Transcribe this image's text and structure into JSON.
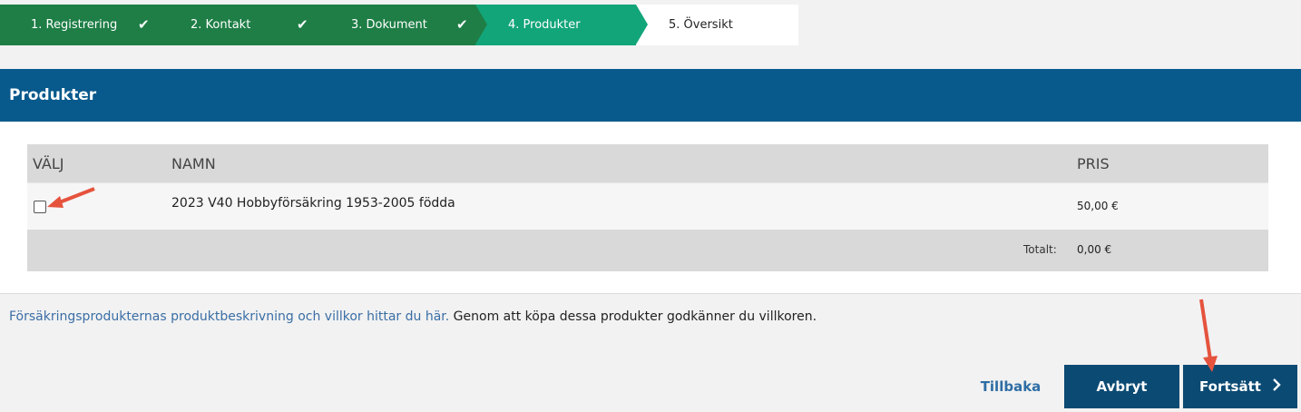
{
  "stepper": {
    "steps": [
      {
        "label": "1. Registrering",
        "check": "✔"
      },
      {
        "label": "2. Kontakt",
        "check": "✔"
      },
      {
        "label": "3. Dokument",
        "check": "✔"
      },
      {
        "label": "4. Produkter"
      },
      {
        "label": "5. Översikt"
      }
    ],
    "active_index": 3
  },
  "panel": {
    "title": "Produkter",
    "table": {
      "columns": [
        "VÄLJ",
        "NAMN",
        "PRIS"
      ],
      "rows": [
        {
          "selected": false,
          "name": "2023 V40 Hobbyförsäkring 1953-2005 födda",
          "price": "50,00 €"
        }
      ],
      "total_label": "Totalt:",
      "total_value": "0,00 €"
    }
  },
  "footer": {
    "link_text": "Försäkringsprodukternas produktbeskrivning och villkor hittar du här.",
    "note_text": " Genom att köpa dessa produkter godkänner du villkoren."
  },
  "actions": {
    "back_label": "Tillbaka",
    "cancel_label": "Avbryt",
    "next_label": "Fortsätt",
    "next_icon": "chevron-right-icon"
  },
  "colors": {
    "step_done": "#1e7e46",
    "step_active": "#13a57a",
    "header": "#08598c",
    "button": "#0b4a73",
    "link": "#3a6ea5",
    "annotation_arrow": "#e5533d"
  }
}
